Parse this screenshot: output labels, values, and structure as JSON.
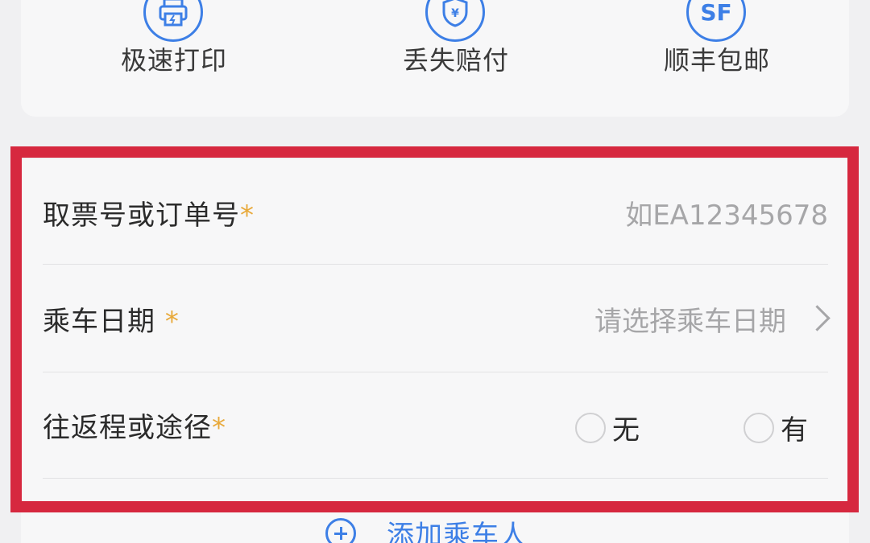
{
  "features": [
    {
      "label": "极速打印",
      "icon": "printer-bolt-icon"
    },
    {
      "label": "丢失赔付",
      "icon": "shield-yen-icon"
    },
    {
      "label": "顺丰包邮",
      "icon": "sf-express-icon"
    }
  ],
  "form": {
    "ticket_number": {
      "label": "取票号或订单号",
      "required_mark": "*",
      "placeholder": "如EA12345678"
    },
    "travel_date": {
      "label": "乘车日期",
      "required_mark": "*",
      "placeholder": "请选择乘车日期"
    },
    "round_trip": {
      "label": "往返程或途径",
      "required_mark": "*",
      "options": [
        "无",
        "有"
      ]
    }
  },
  "add_passenger": {
    "label": "添加乘车人"
  },
  "colors": {
    "accent": "#3d7fe6",
    "required": "#e8a93a",
    "highlight": "#d6283f",
    "placeholder": "#a6a6a8"
  }
}
